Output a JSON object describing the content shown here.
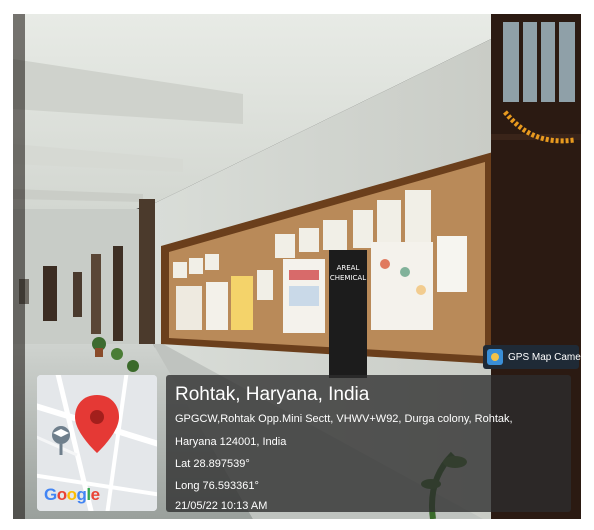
{
  "gps_badge": {
    "label": "GPS Map Camera",
    "icon": "gps-camera-icon"
  },
  "location": {
    "title": "Rohtak, Haryana, India",
    "address_line_1": "GPGCW,Rohtak Opp.Mini Sectt, VHWV+W92, Durga colony, Rohtak,",
    "address_line_2": "Haryana 124001, India",
    "latitude": "Lat 28.897539°",
    "longitude": "Long 76.593361°",
    "timestamp": "21/05/22 10:13 AM"
  },
  "map_thumbnail": {
    "brand": "Google",
    "icons": [
      "map-pin-icon",
      "school-icon"
    ]
  },
  "notice_board": {
    "poster_text": "AREAL CHEMICAL"
  },
  "colors": {
    "pin": "#e53935",
    "google_blue": "#4285F4",
    "google_red": "#EA4335",
    "google_yellow": "#FBBC05",
    "google_green": "#34A853"
  }
}
